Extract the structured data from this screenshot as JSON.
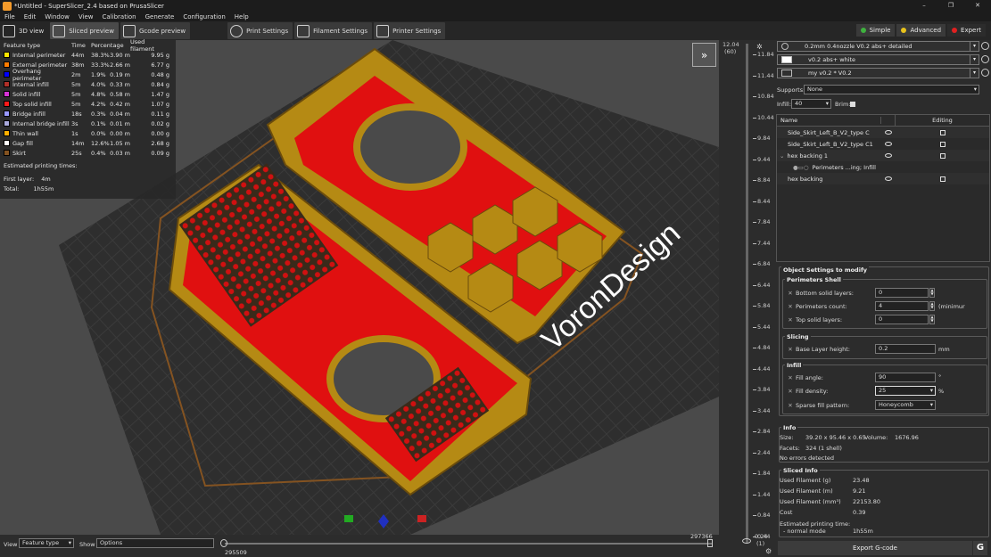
{
  "window": {
    "title": "*Untitled - SuperSlicer_2.4  based on PrusaSlicer",
    "controls": [
      "–",
      "❐",
      "✕"
    ]
  },
  "menu": [
    "File",
    "Edit",
    "Window",
    "View",
    "Calibration",
    "Generate",
    "Configuration",
    "Help"
  ],
  "toolbar": {
    "tabs": [
      "3D view",
      "Sliced preview",
      "Gcode preview",
      "Print Settings",
      "Filament Settings",
      "Printer Settings"
    ],
    "modes": [
      {
        "label": "Simple",
        "color": "#3fb13f"
      },
      {
        "label": "Advanced",
        "color": "#e8c21c"
      },
      {
        "label": "Expert",
        "color": "#e02020"
      }
    ]
  },
  "legend": {
    "headers": [
      "Feature type",
      "Time",
      "Percentage",
      "Used filament"
    ],
    "rows": [
      {
        "name": "Internal perimeter",
        "color": "#ffe600",
        "time": "44m",
        "pct": "38.3%",
        "m": "3.90 m",
        "g": "9.95 g"
      },
      {
        "name": "External perimeter",
        "color": "#ff7d00",
        "time": "38m",
        "pct": "33.3%",
        "m": "2.66 m",
        "g": "6.77 g"
      },
      {
        "name": "Overhang perimeter",
        "color": "#0000ff",
        "time": "2m",
        "pct": "1.9%",
        "m": "0.19 m",
        "g": "0.48 g"
      },
      {
        "name": "Internal infill",
        "color": "#b03029",
        "time": "5m",
        "pct": "4.0%",
        "m": "0.33 m",
        "g": "0.84 g"
      },
      {
        "name": "Solid infill",
        "color": "#d732d7",
        "time": "5m",
        "pct": "4.8%",
        "m": "0.58 m",
        "g": "1.47 g"
      },
      {
        "name": "Top solid infill",
        "color": "#ff1a1a",
        "time": "5m",
        "pct": "4.2%",
        "m": "0.42 m",
        "g": "1.07 g"
      },
      {
        "name": "Bridge infill",
        "color": "#9999ff",
        "time": "18s",
        "pct": "0.3%",
        "m": "0.04 m",
        "g": "0.11 g"
      },
      {
        "name": "Internal bridge infill",
        "color": "#aaaadd",
        "time": "3s",
        "pct": "0.1%",
        "m": "0.01 m",
        "g": "0.02 g"
      },
      {
        "name": "Thin wall",
        "color": "#ffb000",
        "time": "1s",
        "pct": "0.0%",
        "m": "0.00 m",
        "g": "0.00 g"
      },
      {
        "name": "Gap fill",
        "color": "#ffffff",
        "time": "14m",
        "pct": "12.6%",
        "m": "1.05 m",
        "g": "2.68 g"
      },
      {
        "name": "Skirt",
        "color": "#845321",
        "time": "25s",
        "pct": "0.4%",
        "m": "0.03 m",
        "g": "0.09 g"
      }
    ],
    "estimated": "Estimated printing times:",
    "first_layer_label": "First layer:",
    "first_layer": "4m",
    "total_label": "Total:",
    "total": "1h55m"
  },
  "presets": {
    "print": "0.2mm 0.4nozzle V0.2 abs+ detailed",
    "filament": "v0.2 abs+ white",
    "printer": "my v0.2 * V0.2"
  },
  "supports": {
    "label": "Supports:",
    "value": "None"
  },
  "infill": {
    "label": "Infill:",
    "value": "40",
    "brim_label": "Brim:"
  },
  "tree": {
    "col_name": "Name",
    "col_editing": "Editing",
    "items": [
      "Side_Skirt_Left_B_V2_type C",
      "Side_Skirt_Left_B_V2_type C1",
      "hex backing 1",
      "Perimeters ...ing; Infill",
      "hex backing"
    ]
  },
  "object_settings": {
    "title": "Object Settings to modify",
    "perimeters_shell": "Perimeters  Shell",
    "bottom_solid_label": "Bottom solid layers:",
    "bottom_solid": "0",
    "perimeters_count_label": "Perimeters count:",
    "perimeters_count": "4",
    "perimeters_suffix": "(minimur",
    "top_solid_label": "Top solid layers:",
    "top_solid": "0",
    "slicing": "Slicing",
    "base_layer_label": "Base Layer height:",
    "base_layer": "0.2",
    "base_layer_unit": "mm",
    "infill_title": "Infill",
    "fill_angle_label": "Fill angle:",
    "fill_angle": "90",
    "fill_angle_unit": "°",
    "fill_density_label": "Fill density:",
    "fill_density": "25",
    "fill_density_unit": "%",
    "sparse_label": "Sparse fill pattern:",
    "sparse": "Honeycomb"
  },
  "info": {
    "title": "Info",
    "size_label": "Size:",
    "size": "39.20 x 95.46 x 0.65",
    "volume_label": "Volume:",
    "volume": "1676.96",
    "facets_label": "Facets:",
    "facets": "324 (1 shell)",
    "errors": "No errors detected"
  },
  "sliced": {
    "title": "Sliced Info",
    "rows": [
      {
        "l": "Used Filament (g)",
        "v": "23.48"
      },
      {
        "l": "Used Filament (m)",
        "v": "9.21"
      },
      {
        "l": "Used Filament (mm³)",
        "v": "22153.80"
      },
      {
        "l": "Cost",
        "v": "0.39"
      }
    ],
    "est_label": "Estimated printing time:",
    "normal_label": "- normal mode",
    "normal": "1h55m"
  },
  "export_label": "Export G-code",
  "ruler": {
    "top": "12.04",
    "top_sub": "(60)",
    "bottom": "0.24",
    "bottom_sub": "(1)",
    "ticks": [
      "11.84",
      "11.44",
      "10.84",
      "10.44",
      "9.84",
      "9.44",
      "8.84",
      "8.44",
      "7.84",
      "7.44",
      "6.84",
      "6.44",
      "5.84",
      "5.44",
      "4.84",
      "4.44",
      "3.84",
      "3.44",
      "2.84",
      "2.44",
      "1.84",
      "1.44",
      "0.84",
      "0.44"
    ]
  },
  "bottom": {
    "view_label": "View",
    "view_value": "Feature type",
    "show_label": "Show",
    "show_value": "Options",
    "slider_left": "295509",
    "slider_right": "297366"
  },
  "watermark": "VoronDesign"
}
